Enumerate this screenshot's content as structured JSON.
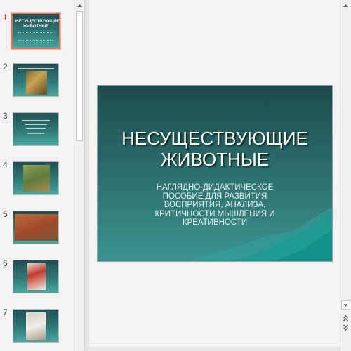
{
  "thumbnails": [
    {
      "number": "1",
      "title": "НЕСУЩЕСТВУЮЩИЕ ЖИВОТНЫЕ",
      "active": true
    },
    {
      "number": "2",
      "image": "cat-photo"
    },
    {
      "number": "3"
    },
    {
      "number": "4",
      "image": "kangaroo-photo"
    },
    {
      "number": "5",
      "image": "animal-photo"
    },
    {
      "number": "6",
      "image": "rooster-photo"
    },
    {
      "number": "7",
      "image": "dog-photo"
    }
  ],
  "slide": {
    "title_line1": "НЕСУЩЕСТВУЮЩИЕ",
    "title_line2": "ЖИВОТНЫЕ",
    "subtitle_line1": "НАГЛЯДНО-ДИДАКТИЧЕСКОЕ",
    "subtitle_line2": "ПОСОБИЕ ДЛЯ РАЗВИТИЯ",
    "subtitle_line3": "ВОСПРИЯТИЯ, АНАЛИЗА,",
    "subtitle_line4": "КРИТИЧНОСТИ МЫШЛЕНИЯ И",
    "subtitle_line5": "КРЕАТИВНОСТИ"
  },
  "scrollbar": {
    "up_icon": "triangle-up-icon",
    "down_icon": "triangle-down-icon",
    "prev_slide_icon": "double-chevron-up-icon",
    "next_slide_icon": "double-chevron-down-icon"
  },
  "colors": {
    "slide_dark": "#1d4a4c",
    "slide_light": "#3c9490",
    "active_border": "#e2705a"
  }
}
